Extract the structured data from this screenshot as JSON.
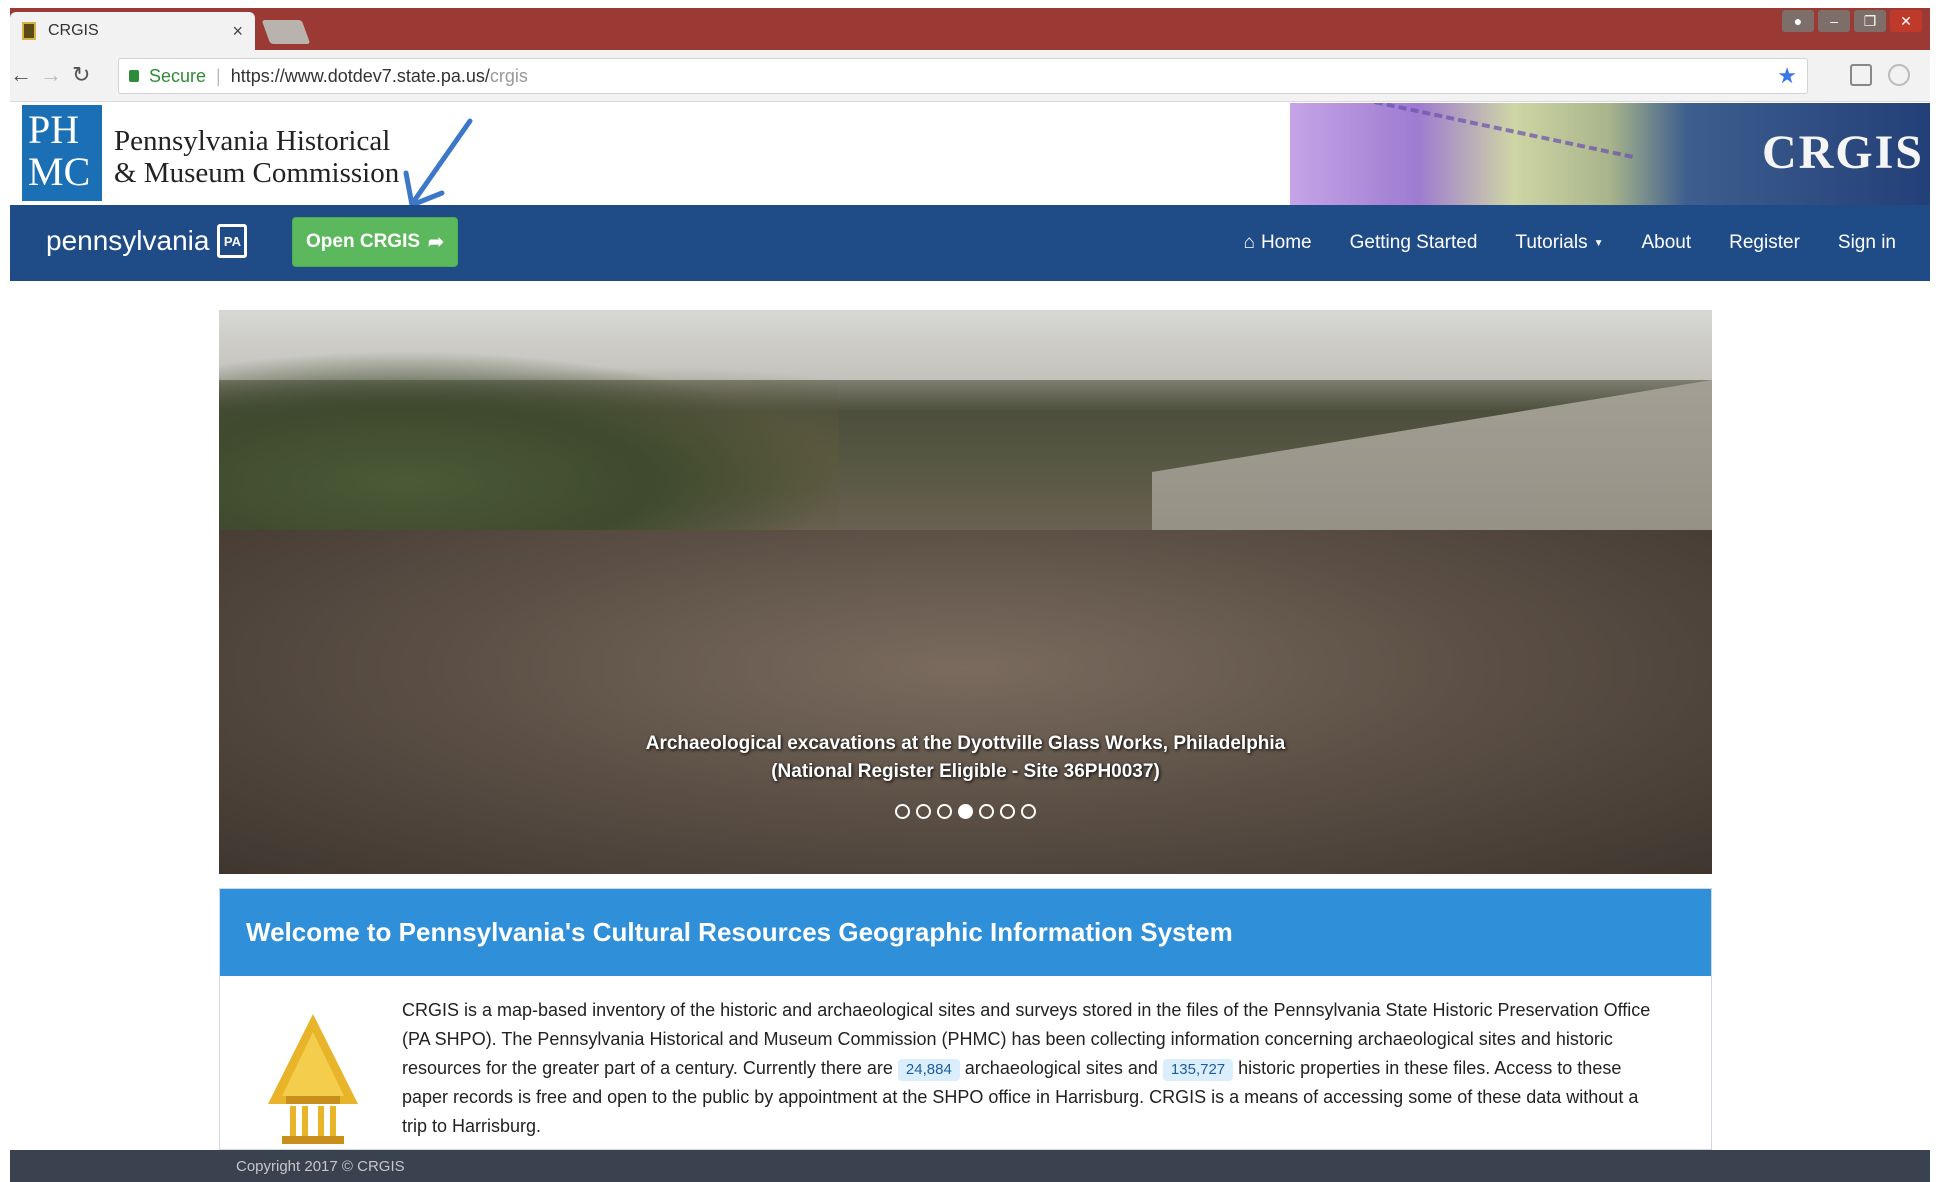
{
  "browser": {
    "tab_title": "CRGIS",
    "tab_close": "×",
    "secure_label": "Secure",
    "url_main": "https://www.dotdev7.state.pa.us/",
    "url_path": "crgis"
  },
  "header": {
    "logo_mark": "PH MC",
    "org_line1": "Pennsylvania Historical",
    "org_line2": "& Museum Commission",
    "banner_title": "CRGIS"
  },
  "navbar": {
    "brand": "pennsylvania",
    "brand_badge": "PA",
    "open_button": "Open CRGIS",
    "links": {
      "home": "Home",
      "getting_started": "Getting Started",
      "tutorials": "Tutorials",
      "about": "About",
      "register": "Register",
      "sign_in": "Sign in"
    }
  },
  "hero": {
    "caption_line1": "Archaeological excavations at the Dyottville Glass Works, Philadelphia",
    "caption_line2": "(National Register Eligible - Site 36PH0037)",
    "slide_count": 7,
    "active_slide": 4
  },
  "welcome": {
    "heading": "Welcome to Pennsylvania's Cultural Resources Geographic Information System",
    "text_before_count1": "CRGIS is a map-based inventory of the historic and archaeological sites and surveys stored in the files of the Pennsylvania State Historic Preservation Office (PA SHPO). The Pennsylvania Historical and Museum Commission (PHMC) has been collecting information concerning archaeological sites and historic resources for the greater part of a century. Currently there are ",
    "archaeological_count": "24,884",
    "text_between_counts": " archaeological sites and ",
    "historic_count": "135,727",
    "text_after_count2": " historic properties in these files. Access to these paper records is free and open to the public by appointment at the SHPO office in Harrisburg. CRGIS is a means of accessing some of these data without a trip to Harrisburg."
  },
  "footer": {
    "copyright": "Copyright 2017 © CRGIS"
  },
  "colors": {
    "navbar": "#1f4b86",
    "open_button": "#5cb85c",
    "panel_heading": "#2f8fd8",
    "footer": "#3a4250",
    "tabstrip": "#9b3a35"
  },
  "icons": {
    "home": "home-icon",
    "open": "share-arrow-icon",
    "star": "star-icon"
  }
}
